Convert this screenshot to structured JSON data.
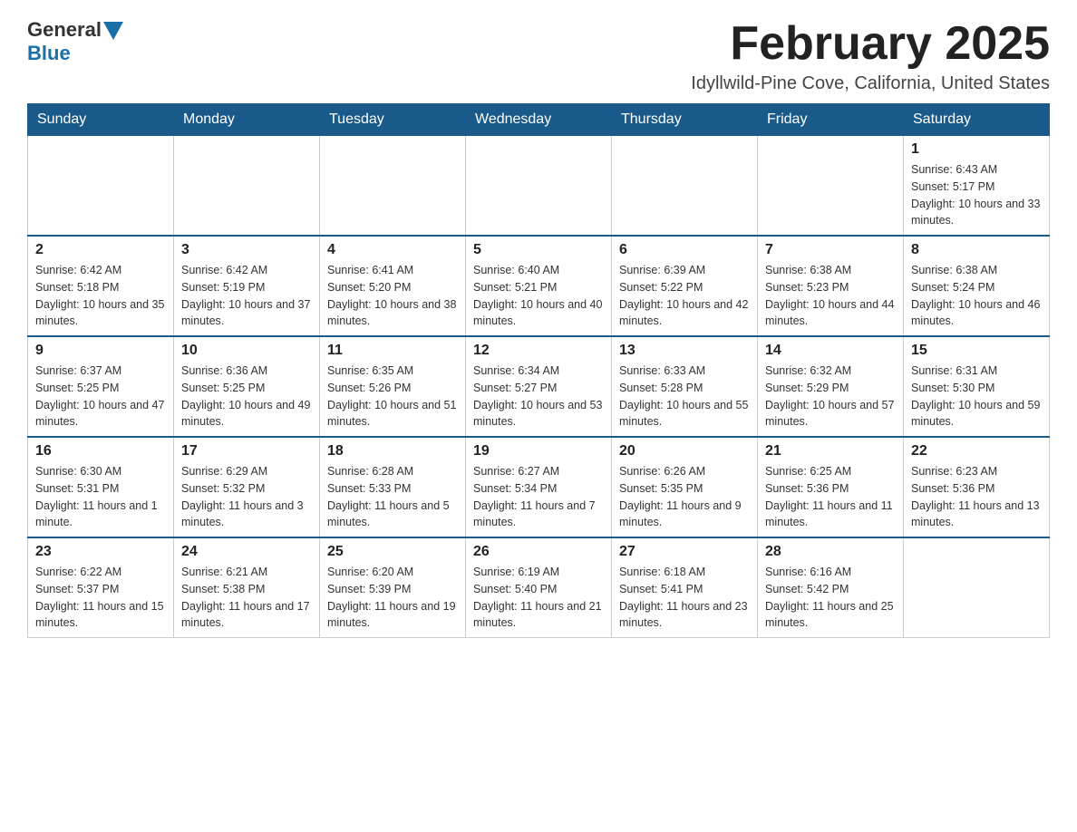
{
  "header": {
    "logo": {
      "general": "General",
      "blue": "Blue",
      "arrow_color": "#1a6fa8"
    },
    "title": "February 2025",
    "subtitle": "Idyllwild-Pine Cove, California, United States"
  },
  "calendar": {
    "days_of_week": [
      "Sunday",
      "Monday",
      "Tuesday",
      "Wednesday",
      "Thursday",
      "Friday",
      "Saturday"
    ],
    "header_bg": "#1a5a8a",
    "weeks": [
      {
        "days": [
          {
            "num": "",
            "info": ""
          },
          {
            "num": "",
            "info": ""
          },
          {
            "num": "",
            "info": ""
          },
          {
            "num": "",
            "info": ""
          },
          {
            "num": "",
            "info": ""
          },
          {
            "num": "",
            "info": ""
          },
          {
            "num": "1",
            "info": "Sunrise: 6:43 AM\nSunset: 5:17 PM\nDaylight: 10 hours and 33 minutes."
          }
        ]
      },
      {
        "days": [
          {
            "num": "2",
            "info": "Sunrise: 6:42 AM\nSunset: 5:18 PM\nDaylight: 10 hours and 35 minutes."
          },
          {
            "num": "3",
            "info": "Sunrise: 6:42 AM\nSunset: 5:19 PM\nDaylight: 10 hours and 37 minutes."
          },
          {
            "num": "4",
            "info": "Sunrise: 6:41 AM\nSunset: 5:20 PM\nDaylight: 10 hours and 38 minutes."
          },
          {
            "num": "5",
            "info": "Sunrise: 6:40 AM\nSunset: 5:21 PM\nDaylight: 10 hours and 40 minutes."
          },
          {
            "num": "6",
            "info": "Sunrise: 6:39 AM\nSunset: 5:22 PM\nDaylight: 10 hours and 42 minutes."
          },
          {
            "num": "7",
            "info": "Sunrise: 6:38 AM\nSunset: 5:23 PM\nDaylight: 10 hours and 44 minutes."
          },
          {
            "num": "8",
            "info": "Sunrise: 6:38 AM\nSunset: 5:24 PM\nDaylight: 10 hours and 46 minutes."
          }
        ]
      },
      {
        "days": [
          {
            "num": "9",
            "info": "Sunrise: 6:37 AM\nSunset: 5:25 PM\nDaylight: 10 hours and 47 minutes."
          },
          {
            "num": "10",
            "info": "Sunrise: 6:36 AM\nSunset: 5:25 PM\nDaylight: 10 hours and 49 minutes."
          },
          {
            "num": "11",
            "info": "Sunrise: 6:35 AM\nSunset: 5:26 PM\nDaylight: 10 hours and 51 minutes."
          },
          {
            "num": "12",
            "info": "Sunrise: 6:34 AM\nSunset: 5:27 PM\nDaylight: 10 hours and 53 minutes."
          },
          {
            "num": "13",
            "info": "Sunrise: 6:33 AM\nSunset: 5:28 PM\nDaylight: 10 hours and 55 minutes."
          },
          {
            "num": "14",
            "info": "Sunrise: 6:32 AM\nSunset: 5:29 PM\nDaylight: 10 hours and 57 minutes."
          },
          {
            "num": "15",
            "info": "Sunrise: 6:31 AM\nSunset: 5:30 PM\nDaylight: 10 hours and 59 minutes."
          }
        ]
      },
      {
        "days": [
          {
            "num": "16",
            "info": "Sunrise: 6:30 AM\nSunset: 5:31 PM\nDaylight: 11 hours and 1 minute."
          },
          {
            "num": "17",
            "info": "Sunrise: 6:29 AM\nSunset: 5:32 PM\nDaylight: 11 hours and 3 minutes."
          },
          {
            "num": "18",
            "info": "Sunrise: 6:28 AM\nSunset: 5:33 PM\nDaylight: 11 hours and 5 minutes."
          },
          {
            "num": "19",
            "info": "Sunrise: 6:27 AM\nSunset: 5:34 PM\nDaylight: 11 hours and 7 minutes."
          },
          {
            "num": "20",
            "info": "Sunrise: 6:26 AM\nSunset: 5:35 PM\nDaylight: 11 hours and 9 minutes."
          },
          {
            "num": "21",
            "info": "Sunrise: 6:25 AM\nSunset: 5:36 PM\nDaylight: 11 hours and 11 minutes."
          },
          {
            "num": "22",
            "info": "Sunrise: 6:23 AM\nSunset: 5:36 PM\nDaylight: 11 hours and 13 minutes."
          }
        ]
      },
      {
        "days": [
          {
            "num": "23",
            "info": "Sunrise: 6:22 AM\nSunset: 5:37 PM\nDaylight: 11 hours and 15 minutes."
          },
          {
            "num": "24",
            "info": "Sunrise: 6:21 AM\nSunset: 5:38 PM\nDaylight: 11 hours and 17 minutes."
          },
          {
            "num": "25",
            "info": "Sunrise: 6:20 AM\nSunset: 5:39 PM\nDaylight: 11 hours and 19 minutes."
          },
          {
            "num": "26",
            "info": "Sunrise: 6:19 AM\nSunset: 5:40 PM\nDaylight: 11 hours and 21 minutes."
          },
          {
            "num": "27",
            "info": "Sunrise: 6:18 AM\nSunset: 5:41 PM\nDaylight: 11 hours and 23 minutes."
          },
          {
            "num": "28",
            "info": "Sunrise: 6:16 AM\nSunset: 5:42 PM\nDaylight: 11 hours and 25 minutes."
          },
          {
            "num": "",
            "info": ""
          }
        ]
      }
    ]
  }
}
